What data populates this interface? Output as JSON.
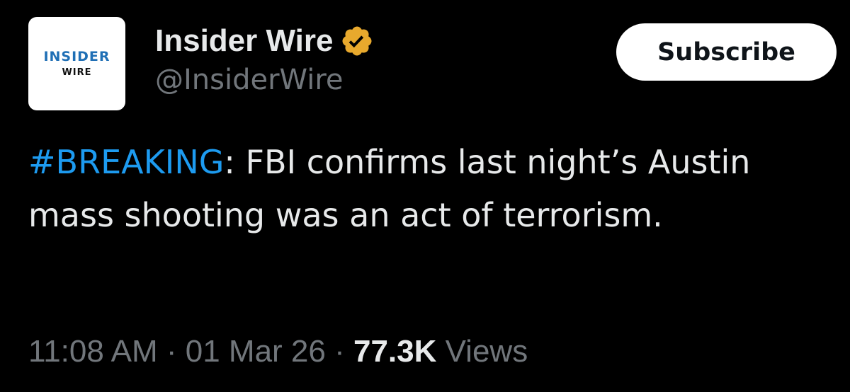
{
  "account": {
    "logo_line1": "INSIDER",
    "logo_line2": "WIRE",
    "display_name": "Insider Wire",
    "handle": "@InsiderWire",
    "verified_icon": "verified-badge-icon",
    "verified_color": "#e8a92d",
    "logo_line1_color": "#1f6fb5",
    "logo_line2_color": "#111111"
  },
  "subscribe": {
    "label": "Subscribe"
  },
  "tweet": {
    "hashtag": "#BREAKING",
    "text_after_hashtag": ": FBI confirms last night’s Austin mass shooting was an act of terrorism.",
    "hashtag_color": "#1d9bf0"
  },
  "meta": {
    "time": "11:08 AM",
    "separator1": " · ",
    "date": "01 Mar 26",
    "separator2": " · ",
    "views_count": "77.3K",
    "views_label": " Views"
  }
}
